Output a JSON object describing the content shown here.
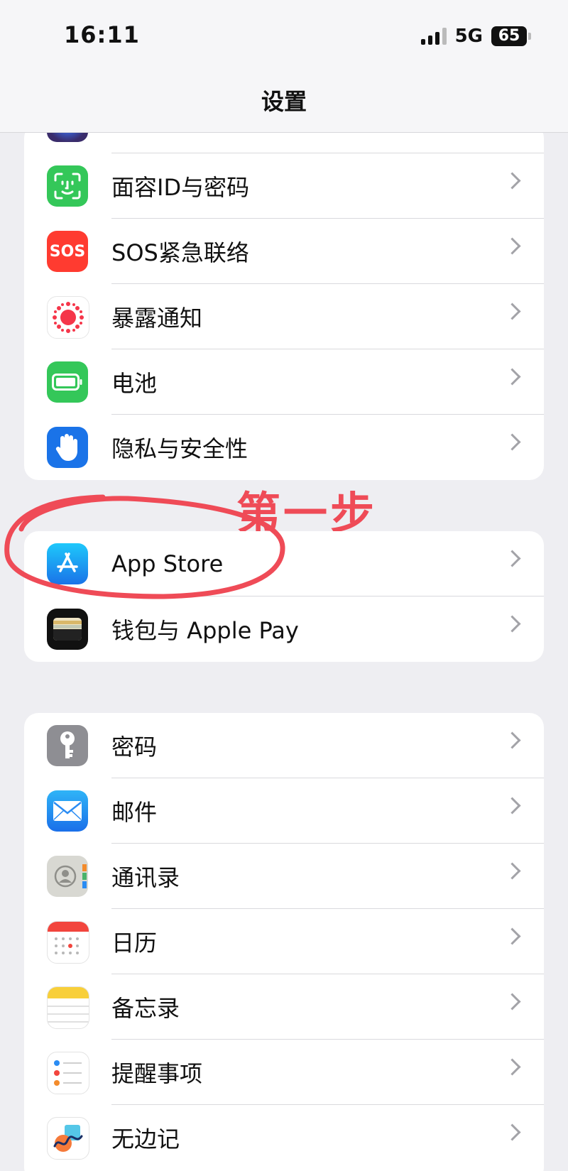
{
  "status_bar": {
    "time": "16:11",
    "network": "5G",
    "battery": "65"
  },
  "nav": {
    "title": "设置"
  },
  "groups": [
    {
      "items": [
        {
          "label": "面容ID与密码",
          "icon": "face-id-icon"
        },
        {
          "label": "SOS紧急联络",
          "icon": "sos-icon",
          "icon_text": "SOS"
        },
        {
          "label": "暴露通知",
          "icon": "exposure-notification-icon"
        },
        {
          "label": "电池",
          "icon": "battery-icon"
        },
        {
          "label": "隐私与安全性",
          "icon": "hand-privacy-icon"
        }
      ]
    },
    {
      "items": [
        {
          "label": "App Store",
          "icon": "app-store-icon"
        },
        {
          "label": "钱包与 Apple Pay",
          "icon": "wallet-icon"
        }
      ]
    },
    {
      "items": [
        {
          "label": "密码",
          "icon": "key-icon"
        },
        {
          "label": "邮件",
          "icon": "mail-icon"
        },
        {
          "label": "通讯录",
          "icon": "contacts-icon"
        },
        {
          "label": "日历",
          "icon": "calendar-icon"
        },
        {
          "label": "备忘录",
          "icon": "notes-icon"
        },
        {
          "label": "提醒事项",
          "icon": "reminders-icon"
        },
        {
          "label": "无边记",
          "icon": "freeform-icon"
        }
      ]
    }
  ],
  "annotation": {
    "text": "第一步",
    "color": "#ef4b57"
  },
  "colors": {
    "face_id": "#34c759",
    "sos": "#ff3b30",
    "battery": "#34c759",
    "privacy": "#1a73e8",
    "app_store": "#1e8ef5",
    "mail": "#2a8cf3",
    "key": "#8e8e93"
  }
}
